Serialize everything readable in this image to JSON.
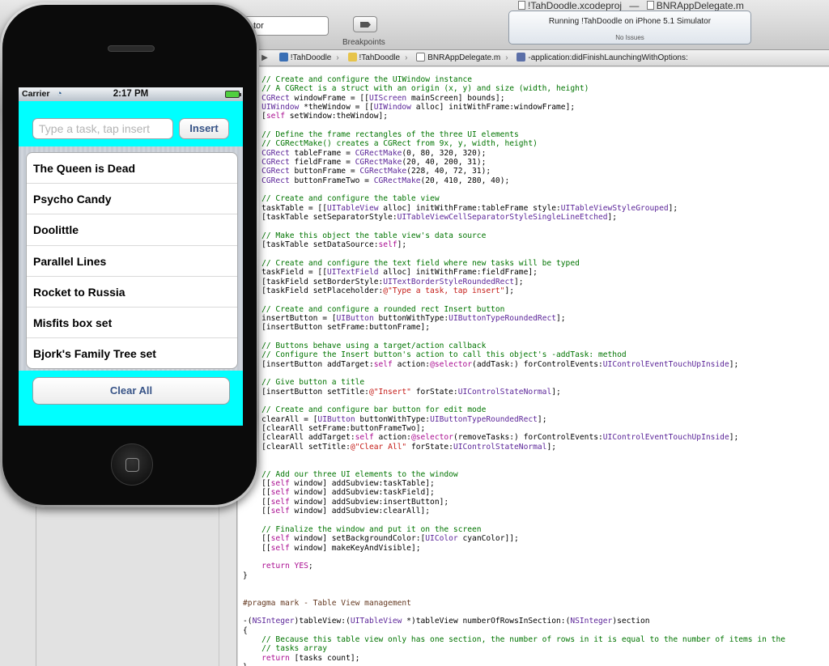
{
  "window": {
    "project_tab": "!TahDoodle.xcodeproj",
    "separator": "—",
    "file_tab": "BNRAppDelegate.m"
  },
  "toolbar": {
    "scheme_partial": "tor",
    "breakpoints_label": "Breakpoints",
    "activity_status": "Running !TahDoodle on iPhone 5.1 Simulator",
    "activity_issues": "No Issues"
  },
  "jumpbar": {
    "crumbs": [
      {
        "label": "!TahDoodle",
        "icon": "project-icon"
      },
      {
        "label": "!TahDoodle",
        "icon": "folder-icon"
      },
      {
        "label": "BNRAppDelegate.m",
        "icon": "m-file-icon"
      },
      {
        "label": "-application:didFinishLaunchingWithOptions:",
        "icon": "method-icon"
      }
    ]
  },
  "simulator": {
    "carrier": "Carrier",
    "time": "2:17 PM",
    "task_placeholder": "Type a task, tap insert",
    "insert_label": "Insert",
    "tasks": [
      "The Queen is Dead",
      "Psycho Candy",
      "Doolittle",
      "Parallel Lines",
      "Rocket to Russia",
      "Misfits box set",
      "Bjork's Family Tree set"
    ],
    "clear_label": "Clear All"
  },
  "code_lines": [
    "    // Create and configure the UIWindow instance",
    "    // A CGRect is a struct with an origin (x, y) and size (width, height)",
    "    CGRect windowFrame = [[UIScreen mainScreen] bounds];",
    "    UIWindow *theWindow = [[UIWindow alloc] initWithFrame:windowFrame];",
    "    [self setWindow:theWindow];",
    "",
    "    // Define the frame rectangles of the three UI elements",
    "    // CGRectMake() creates a CGRect from 9x, y, width, height)",
    "    CGRect tableFrame = CGRectMake(0, 80, 320, 320);",
    "    CGRect fieldFrame = CGRectMake(20, 40, 200, 31);",
    "    CGRect buttonFrame = CGRectMake(228, 40, 72, 31);",
    "    CGRect buttonFrameTwo = CGRectMake(20, 410, 280, 40);",
    "",
    "    // Create and configure the table view",
    "    taskTable = [[UITableView alloc] initWithFrame:tableFrame style:UITableViewStyleGrouped];",
    "    [taskTable setSeparatorStyle:UITableViewCellSeparatorStyleSingleLineEtched];",
    "",
    "    // Make this object the table view's data source",
    "    [taskTable setDataSource:self];",
    "",
    "    // Create and configure the text field where new tasks will be typed",
    "    taskField = [[UITextField alloc] initWithFrame:fieldFrame];",
    "    [taskField setBorderStyle:UITextBorderStyleRoundedRect];",
    "    [taskField setPlaceholder:@\"Type a task, tap insert\"];",
    "",
    "    // Create and configure a rounded rect Insert button",
    "    insertButton = [UIButton buttonWithType:UIButtonTypeRoundedRect];",
    "    [insertButton setFrame:buttonFrame];",
    "",
    "    // Buttons behave using a target/action callback",
    "    // Configure the Insert button's action to call this object's -addTask: method",
    "    [insertButton addTarget:self action:@selector(addTask:) forControlEvents:UIControlEventTouchUpInside];",
    "",
    "    // Give button a title",
    "    [insertButton setTitle:@\"Insert\" forState:UIControlStateNormal];",
    "",
    "    // Create and configure bar button for edit mode",
    "    clearAll = [UIButton buttonWithType:UIButtonTypeRoundedRect];",
    "    [clearAll setFrame:buttonFrameTwo];",
    "    [clearAll addTarget:self action:@selector(removeTasks:) forControlEvents:UIControlEventTouchUpInside];",
    "    [clearAll setTitle:@\"Clear All\" forState:UIControlStateNormal];",
    "",
    "",
    "    // Add our three UI elements to the window",
    "    [[self window] addSubview:taskTable];",
    "    [[self window] addSubview:taskField];",
    "    [[self window] addSubview:insertButton];",
    "    [[self window] addSubview:clearAll];",
    "",
    "    // Finalize the window and put it on the screen",
    "    [[self window] setBackgroundColor:[UIColor cyanColor]];",
    "    [[self window] makeKeyAndVisible];",
    "",
    "    return YES;",
    "}",
    "",
    "",
    "#pragma mark - Table View management",
    "",
    "-(NSInteger)tableView:(UITableView *)tableView numberOfRowsInSection:(NSInteger)section",
    "{",
    "    // Because this table view only has one section, the number of rows in it is equal to the number of items in the",
    "    // tasks array",
    "    return [tasks count];",
    "}"
  ],
  "colors": {
    "simulator_background": "#00ffff",
    "button_text": "#385487",
    "comment": "#007400",
    "keyword": "#aa0d91",
    "type": "#5c2699",
    "string": "#c41a16"
  }
}
